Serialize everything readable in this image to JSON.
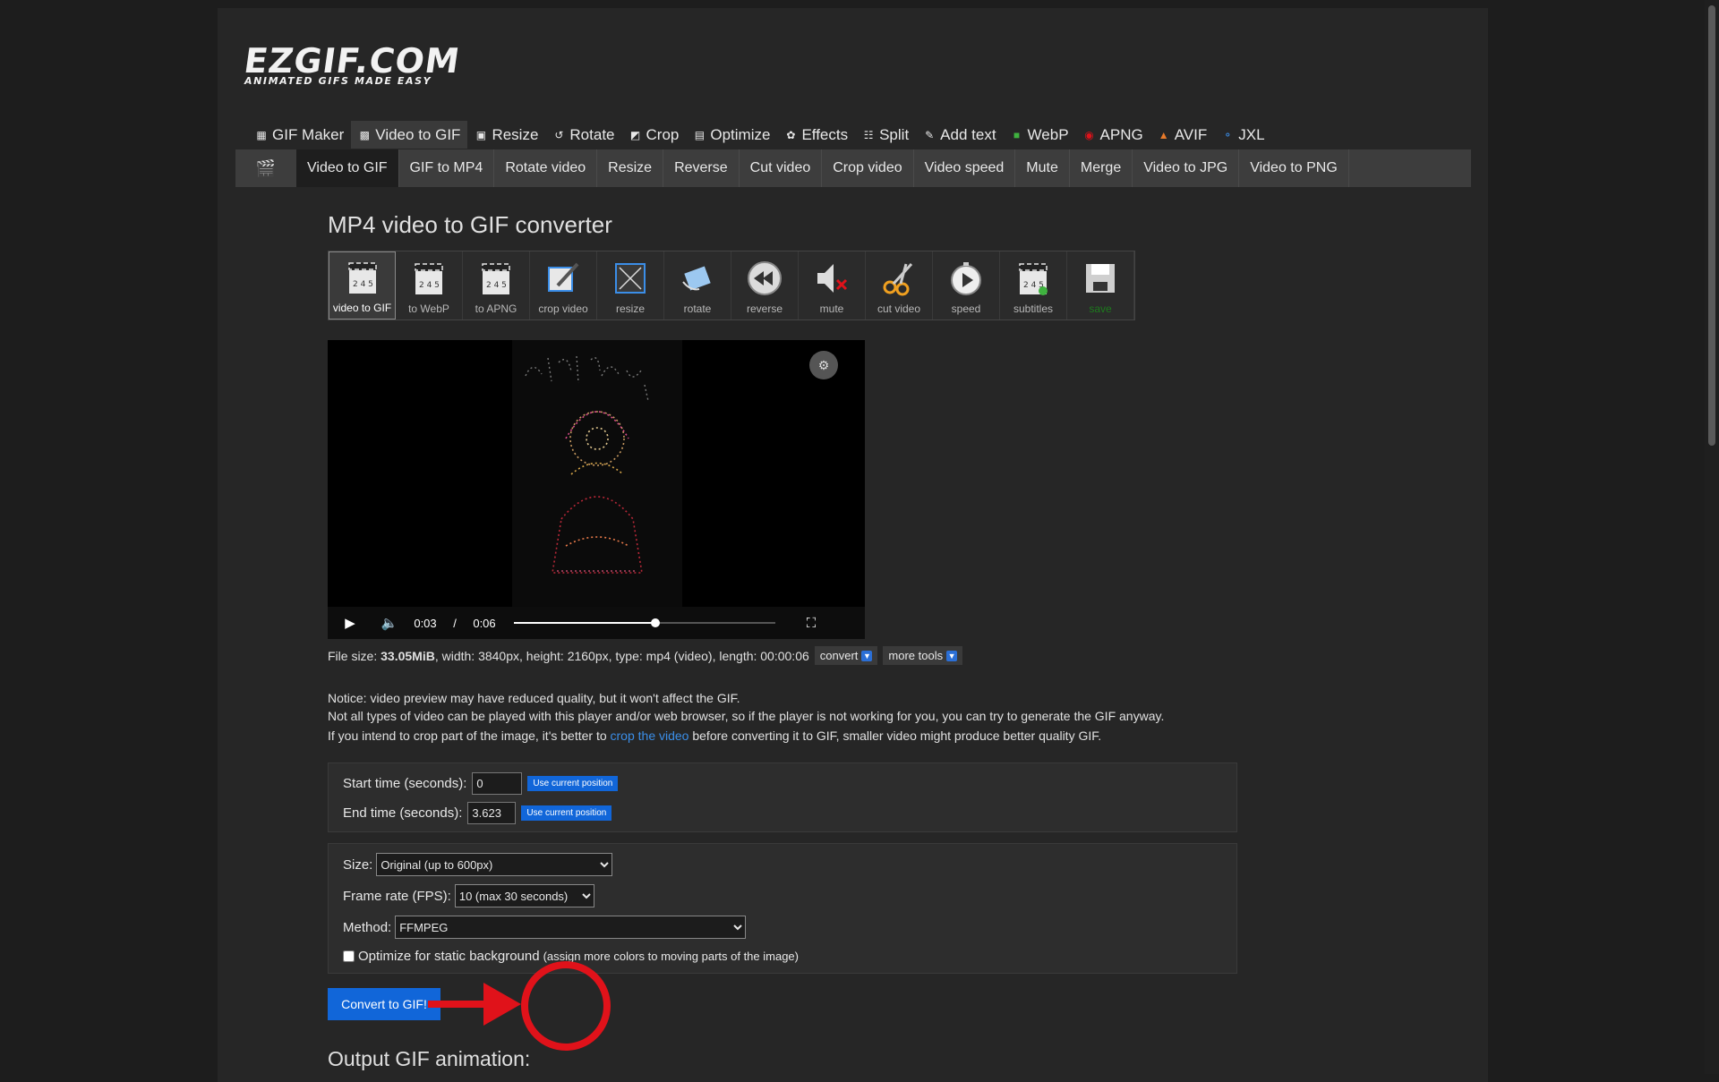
{
  "logo": {
    "main": "EZGIF.COM",
    "tagline": "ANIMATED GIFS MADE EASY"
  },
  "topnav": [
    {
      "label": "GIF Maker",
      "icon": "gif-maker-icon",
      "active": false
    },
    {
      "label": "Video to GIF",
      "icon": "film-icon",
      "active": true
    },
    {
      "label": "Resize",
      "icon": "resize-icon",
      "active": false
    },
    {
      "label": "Rotate",
      "icon": "rotate-icon",
      "active": false
    },
    {
      "label": "Crop",
      "icon": "crop-icon",
      "active": false
    },
    {
      "label": "Optimize",
      "icon": "optimize-icon",
      "active": false
    },
    {
      "label": "Effects",
      "icon": "palette-icon",
      "active": false
    },
    {
      "label": "Split",
      "icon": "split-icon",
      "active": false
    },
    {
      "label": "Add text",
      "icon": "text-icon",
      "active": false
    },
    {
      "label": "WebP",
      "icon": "webp-icon",
      "active": false
    },
    {
      "label": "APNG",
      "icon": "apng-icon",
      "active": false
    },
    {
      "label": "AVIF",
      "icon": "avif-icon",
      "active": false
    },
    {
      "label": "JXL",
      "icon": "jxl-icon",
      "active": false
    }
  ],
  "subnav": [
    {
      "label": "Video to GIF",
      "active": true
    },
    {
      "label": "GIF to MP4",
      "active": false
    },
    {
      "label": "Rotate video",
      "active": false
    },
    {
      "label": "Resize",
      "active": false
    },
    {
      "label": "Reverse",
      "active": false
    },
    {
      "label": "Cut video",
      "active": false
    },
    {
      "label": "Crop video",
      "active": false
    },
    {
      "label": "Video speed",
      "active": false
    },
    {
      "label": "Mute",
      "active": false
    },
    {
      "label": "Merge",
      "active": false
    },
    {
      "label": "Video to JPG",
      "active": false
    },
    {
      "label": "Video to PNG",
      "active": false
    }
  ],
  "page_title": "MP4 video to GIF converter",
  "tools": [
    {
      "label": "video to GIF",
      "icon": "clapper-icon",
      "active": true
    },
    {
      "label": "to WebP",
      "icon": "clapper-icon",
      "active": false
    },
    {
      "label": "to APNG",
      "icon": "clapper-icon",
      "active": false
    },
    {
      "label": "crop video",
      "icon": "crop-pen-icon",
      "active": false
    },
    {
      "label": "resize",
      "icon": "resize-frame-icon",
      "active": false
    },
    {
      "label": "rotate",
      "icon": "rotate-arrow-icon",
      "active": false
    },
    {
      "label": "reverse",
      "icon": "rewind-icon",
      "active": false
    },
    {
      "label": "mute",
      "icon": "speaker-mute-icon",
      "active": false
    },
    {
      "label": "cut video",
      "icon": "scissors-icon",
      "active": false
    },
    {
      "label": "speed",
      "icon": "stopwatch-icon",
      "active": false
    },
    {
      "label": "subtitles",
      "icon": "clapper-subtitles-icon",
      "active": false
    },
    {
      "label": "save",
      "icon": "floppy-icon",
      "active": false
    }
  ],
  "player": {
    "current": "0:03",
    "separator": "/",
    "duration": "0:06",
    "progress": 0.54
  },
  "fileinfo": {
    "prefix": "File size: ",
    "size": "33.05MiB",
    "rest": ", width: 3840px, height: 2160px, type: mp4 (video), length: 00:00:06",
    "convert_label": "convert",
    "more_tools_label": "more tools"
  },
  "notice": {
    "line1": "Notice: video preview may have reduced quality, but it won't affect the GIF.",
    "line2": "Not all types of video can be played with this player and/or web browser, so if the player is not working for you, you can try to generate the GIF anyway.",
    "line3_before": "If you intend to crop part of the image, it's better to ",
    "line3_link": "crop the video",
    "line3_after": " before converting it to GIF, smaller video might produce better quality GIF."
  },
  "time": {
    "start_label": "Start time (seconds):",
    "start_value": "0",
    "end_label": "End time (seconds):",
    "end_value": "3.623",
    "use_current_label": "Use current position"
  },
  "options": {
    "size_label": "Size:",
    "size_value": "Original (up to 600px)",
    "fps_label": "Frame rate (FPS):",
    "fps_value": "10 (max 30 seconds)",
    "method_label": "Method:",
    "method_value": "FFMPEG",
    "optimize_label": "Optimize for static background",
    "optimize_note": "(assign more colors to moving parts of the image)"
  },
  "convert_button": "Convert to GIF!",
  "output_title": "Output GIF animation:",
  "colors": {
    "accent": "#1166d9",
    "highlight": "#e0121a",
    "link": "#3b8ee8"
  }
}
